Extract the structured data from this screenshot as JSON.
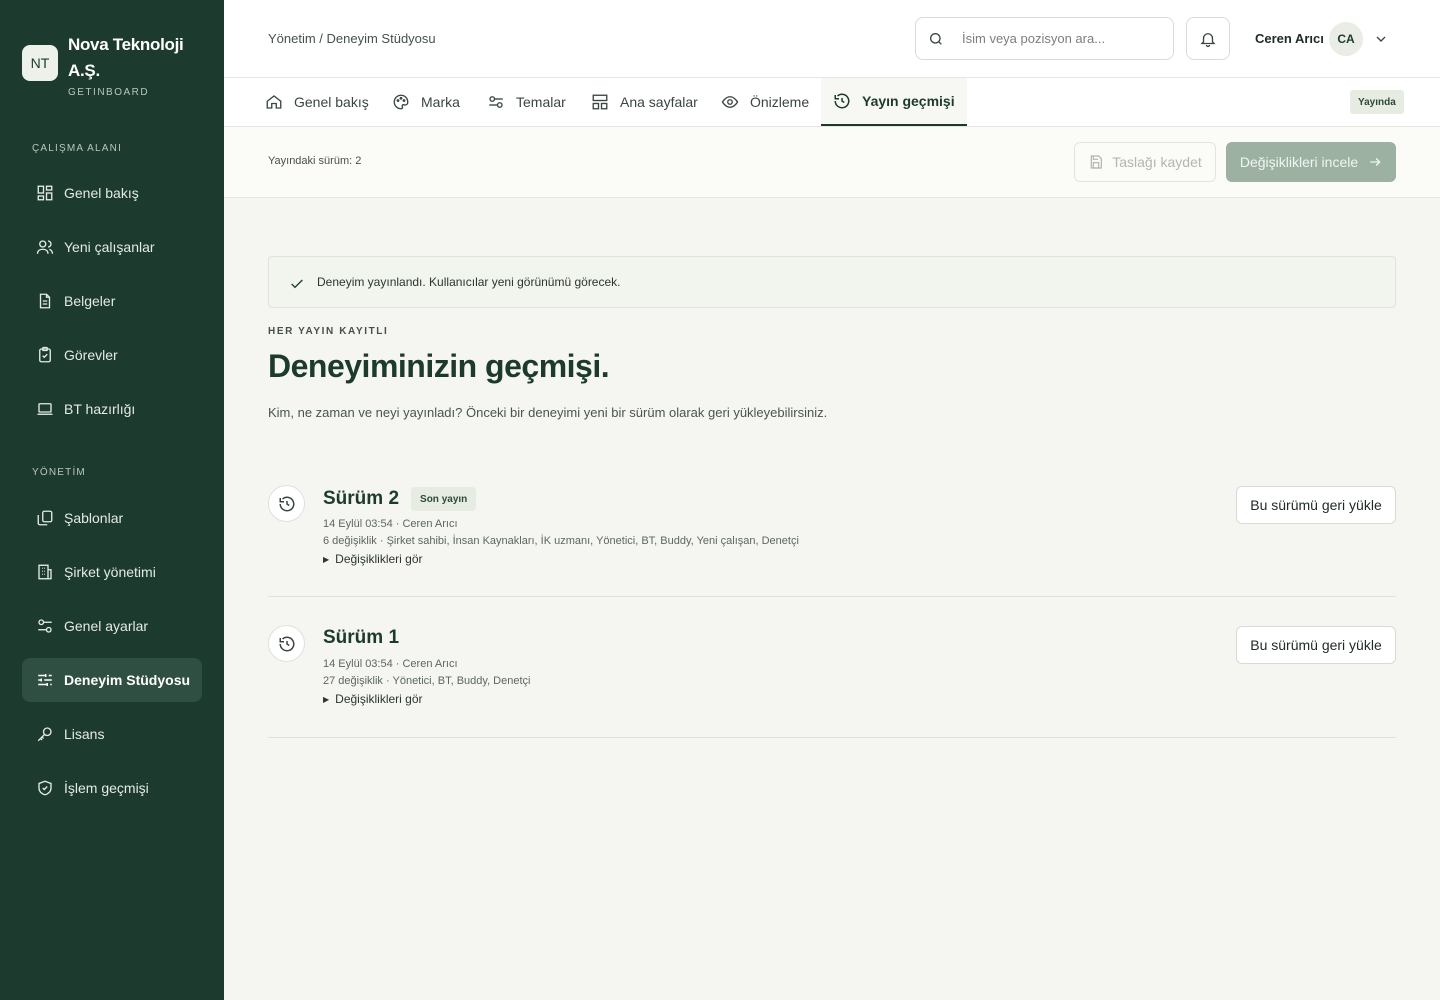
{
  "brand": {
    "logo": "NT",
    "name": "Nova Teknoloji A.Ş.",
    "sub": "GETINBOARD"
  },
  "sidebar": {
    "section1": "ÇALIŞMA ALANI",
    "section2": "YÖNETİM",
    "items": [
      {
        "label": "Genel bakış",
        "icon": "dashboard-icon"
      },
      {
        "label": "Yeni çalışanlar",
        "icon": "users-icon"
      },
      {
        "label": "Belgeler",
        "icon": "document-icon"
      },
      {
        "label": "Görevler",
        "icon": "clipboard-check-icon"
      },
      {
        "label": "BT hazırlığı",
        "icon": "laptop-icon"
      },
      {
        "label": "Şablonlar",
        "icon": "copy-icon"
      },
      {
        "label": "Şirket yönetimi",
        "icon": "building-icon"
      },
      {
        "label": "Genel ayarlar",
        "icon": "settings-sliders-icon"
      },
      {
        "label": "Deneyim Stüdyosu",
        "icon": "sliders-icon",
        "active": true
      },
      {
        "label": "Lisans",
        "icon": "key-icon"
      },
      {
        "label": "İşlem geçmişi",
        "icon": "shield-check-icon"
      }
    ]
  },
  "header": {
    "breadcrumb": "Yönetim / Deneyim Stüdyosu",
    "search_placeholder": "İsim veya pozisyon ara...",
    "user_name": "Ceren Arıcı",
    "user_initials": "CA"
  },
  "tabs": [
    {
      "label": "Genel bakış",
      "icon": "home-icon"
    },
    {
      "label": "Marka",
      "icon": "palette-icon"
    },
    {
      "label": "Temalar",
      "icon": "toggles-icon"
    },
    {
      "label": "Ana sayfalar",
      "icon": "layout-icon"
    },
    {
      "label": "Önizleme",
      "icon": "eye-icon"
    },
    {
      "label": "Yayın geçmişi",
      "icon": "history-icon",
      "active": true
    }
  ],
  "status_badge": "Yayında",
  "actionbar": {
    "version_label": "Yayındaki sürüm: 2",
    "save_draft": "Taslağı kaydet",
    "review_changes": "Değişiklikleri incele"
  },
  "content": {
    "alert": "Deneyim yayınlandı. Kullanıcılar yeni görünümü görecek.",
    "eyebrow": "HER YAYIN KAYITLI",
    "title": "Deneyiminizin geçmişi.",
    "description": "Kim, ne zaman ve neyi yayınladı? Önceki bir deneyimi yeni bir sürüm olarak geri yükleyebilirsiniz."
  },
  "versions": [
    {
      "title": "Sürüm 2",
      "badge": "Son yayın",
      "meta": "14 Eylül 03:54 · Ceren Arıcı",
      "changes": "6 değişiklik · Şirket sahibi, İnsan Kaynakları, İK uzmanı, Yönetici, BT, Buddy, Yeni çalışan, Denetçi",
      "toggle": "Değişiklikleri gör",
      "restore": "Bu sürümü geri yükle"
    },
    {
      "title": "Sürüm 1",
      "meta": "14 Eylül 03:54 · Ceren Arıcı",
      "changes": "27 değişiklik · Yönetici, BT, Buddy, Denetçi",
      "toggle": "Değişiklikleri gör",
      "restore": "Bu sürümü geri yükle"
    }
  ],
  "colors": {
    "sidebar_bg": "#1d3a2e",
    "accent": "#1d3a2e",
    "review_button": "#9cb1a2",
    "badge_bg": "#e7ece3"
  }
}
